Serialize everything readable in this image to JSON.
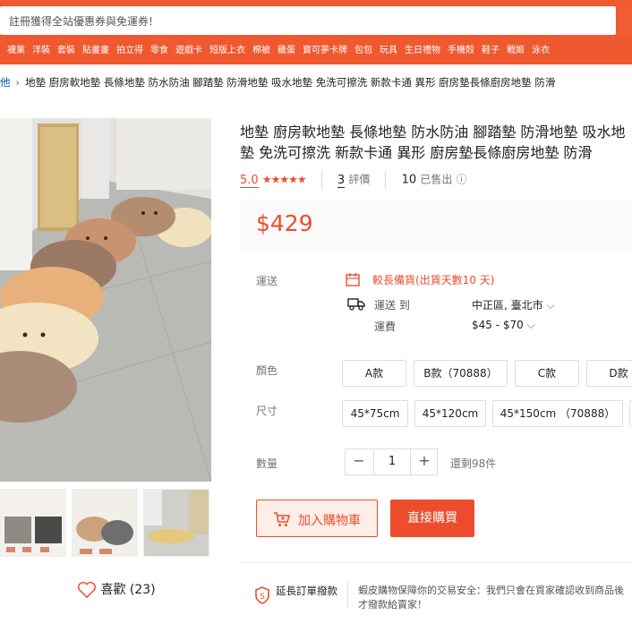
{
  "search": {
    "placeholder": "註冊獲得全站優惠券與免運券!"
  },
  "categories": [
    "襪業",
    "洋裝",
    "套裝",
    "貼畫畫",
    "拍立得",
    "零食",
    "遊戲卡",
    "短版上衣",
    "棉被",
    "雞蛋",
    "寶可夢卡牌",
    "包包",
    "玩具",
    "生日禮物",
    "手機殼",
    "鞋子",
    "戰姬",
    "泳衣"
  ],
  "breadcrumb": {
    "parent": "他",
    "current": "地墊 廚房軟地墊 長條地墊 防水防油 腳踏墊 防滑地墊 吸水地墊 免洗可擦洗 新款卡通 異形 廚房墊長條廚房地墊 防滑"
  },
  "product": {
    "title": "地墊 廚房軟地墊 長條地墊 防水防油 腳踏墊 防滑地墊 吸水地墊 免洗可擦洗 新款卡通 異形 廚房墊長條廚房地墊 防滑",
    "rating": "5.0",
    "stars": "★★★★★",
    "review_count": "3",
    "review_label": "評價",
    "sold_count": "10",
    "sold_label": "已售出",
    "price": "$429"
  },
  "shipping": {
    "label": "運送",
    "notice": "較長備貨(出貨天數10 天)",
    "to_label": "運送 到",
    "to_value": "中正區, 臺北市",
    "fee_label": "運費",
    "fee_value": "$45 - $70"
  },
  "color": {
    "label": "顏色",
    "options": [
      "A款",
      "B款（70888）",
      "C款",
      "D款"
    ]
  },
  "size": {
    "label": "尺寸",
    "options": [
      "45*75cm",
      "45*120cm",
      "45*150cm （70888）"
    ]
  },
  "quantity": {
    "label": "數量",
    "minus": "−",
    "value": "1",
    "plus": "+",
    "remaining": "還剩98件"
  },
  "actions": {
    "add_to_cart": "加入購物車",
    "buy_now": "直接購買"
  },
  "favorite": {
    "label": "喜歡 (23)"
  },
  "guarantee": {
    "title": "延長訂單撥款",
    "text": "蝦皮購物保障你的交易安全：我們只會在買家確認收到商品後才撥款給賣家！"
  },
  "colors": {
    "brand": "#ee4d2d",
    "header": "#f0582f"
  }
}
